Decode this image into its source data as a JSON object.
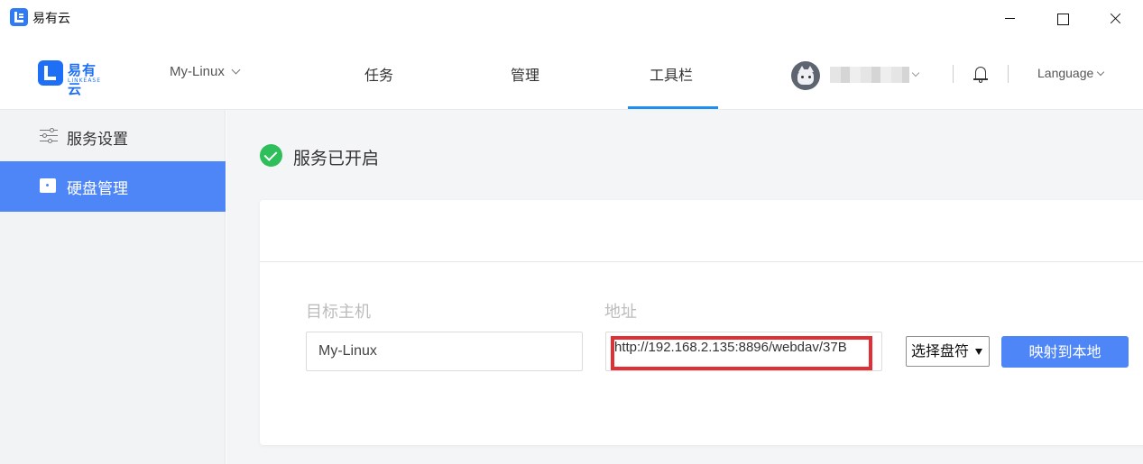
{
  "window": {
    "title": "易有云"
  },
  "header": {
    "logo_text": "易有云",
    "logo_sub": "LINKEASE",
    "device": "My-Linux",
    "tabs": [
      {
        "label": "任务",
        "active": false
      },
      {
        "label": "管理",
        "active": false
      },
      {
        "label": "工具栏",
        "active": true
      }
    ],
    "language": "Language",
    "accent_color": "#1d8ff0"
  },
  "sidebar": {
    "items": [
      {
        "label": "服务设置",
        "icon": "sliders-icon",
        "active": false
      },
      {
        "label": "硬盘管理",
        "icon": "disk-icon",
        "active": true
      }
    ],
    "active_color": "#4f86f7"
  },
  "main": {
    "status_text": "服务已开启",
    "status_color": "#2ebf5a",
    "host_label": "目标主机",
    "host_value": "My-Linux",
    "address_label": "地址",
    "address_value": "http://192.168.2.135:8896/webdav/37B",
    "drive_select": "选择盘符",
    "map_button": "映射到本地"
  }
}
